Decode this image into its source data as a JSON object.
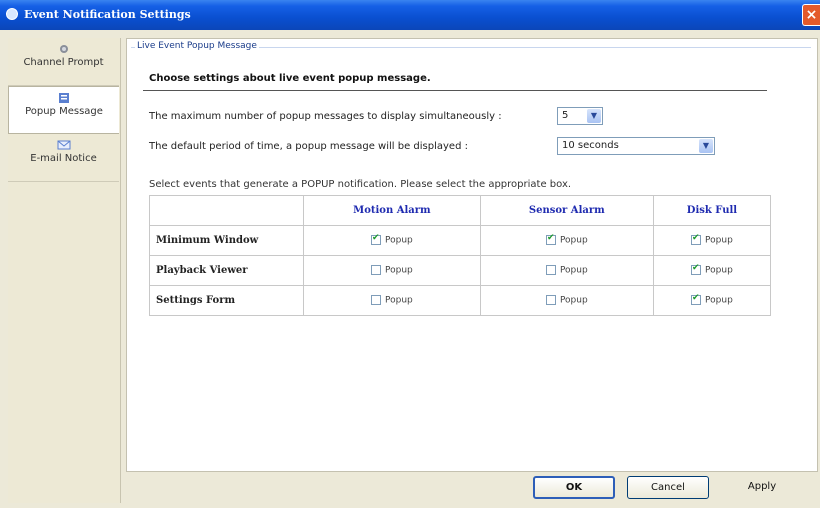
{
  "window": {
    "title": "Event Notification Settings",
    "close_glyph": "×"
  },
  "sidebar": {
    "items": [
      {
        "label": "Channel Prompt",
        "icon": "camera-icon",
        "active": false
      },
      {
        "label": "Popup Message",
        "icon": "popup-icon",
        "active": true
      },
      {
        "label": "E-mail Notice",
        "icon": "email-icon",
        "active": false
      }
    ]
  },
  "panel": {
    "group_title": "Live Event Popup Message",
    "heading": "Choose settings about live event popup message.",
    "max_popups_label": "The maximum number of popup messages to display simultaneously :",
    "max_popups_value": "5",
    "duration_label": "The default period of time, a popup message will be displayed :",
    "duration_value": "10 seconds",
    "instructions": "Select events that generate a POPUP notification. Please select the appropriate box."
  },
  "table": {
    "columns": [
      "",
      "Motion Alarm",
      "Sensor Alarm",
      "Disk Full"
    ],
    "checkbox_label": "Popup",
    "rows": [
      {
        "label": "Minimum Window",
        "checked": [
          true,
          true,
          true
        ]
      },
      {
        "label": "Playback Viewer",
        "checked": [
          false,
          false,
          true
        ]
      },
      {
        "label": "Settings Form",
        "checked": [
          false,
          false,
          true
        ]
      }
    ]
  },
  "buttons": {
    "ok": "OK",
    "cancel": "Cancel",
    "apply": "Apply"
  },
  "colors": {
    "titlebar": "#0a4fd0",
    "header_text": "#1f2bb0",
    "check": "#1d9a2d",
    "close": "#e45a2c"
  }
}
